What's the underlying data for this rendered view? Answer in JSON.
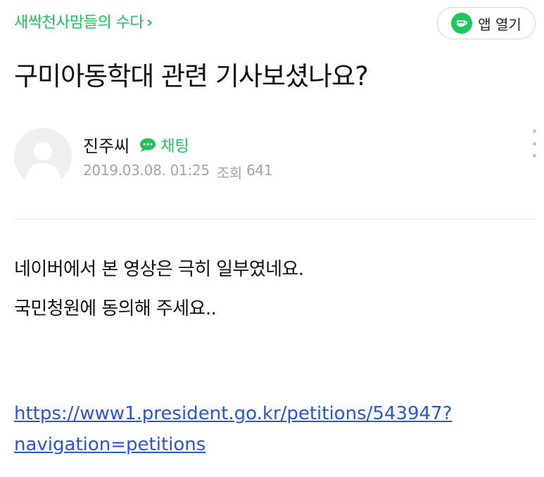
{
  "header": {
    "cafe_name": "새싹천사맘들의 수다",
    "chevron": "›",
    "app_button_label": "앱 열기"
  },
  "post": {
    "title": "구미아동학대 관련 기사보셨나요?",
    "author": "진주씨",
    "chat_label": "채팅",
    "date": "2019.03.08. 01:25",
    "views_label": "조회",
    "views": "641",
    "body_lines": [
      "네이버에서 본 영상은 극히 일부였네요.",
      "국민청원에 동의해 주세요.."
    ],
    "link_line1": "https://www1.president.go.kr/petitions/543947?",
    "link_line2": "navigation=petitions"
  },
  "colors": {
    "brand_green": "#1fc35a",
    "link_blue": "#2a55d7",
    "meta_gray": "#a5a5a5"
  },
  "icons": [
    "app-icon",
    "chat-icon",
    "more-icon",
    "avatar-placeholder"
  ]
}
